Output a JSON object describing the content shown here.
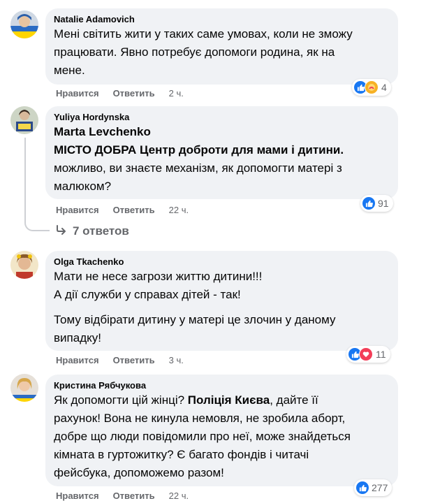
{
  "comments": [
    {
      "author": "Natalie Adamovich",
      "lines": [
        "Мені світить жити у таких саме умовах, коли не зможу",
        "працювати. Явно потребує допомоги родина, як на",
        "мене."
      ],
      "like_label": "Нравится",
      "reply_label": "Ответить",
      "time": "2 ч.",
      "reaction_count": "4"
    },
    {
      "author": "Yuliya Hordynska",
      "mention_1": "Marta Levchenko",
      "mention_2": "МІСТО ДОБРА Центр доброти для мами і дитини.",
      "lines": [
        "можливо, ви знаєте механізм, як допомогти матері з",
        "малюком?"
      ],
      "like_label": "Нравится",
      "reply_label": "Ответить",
      "time": "22 ч.",
      "reaction_count": "91",
      "replies_label": "7 ответов"
    },
    {
      "author": "Olga Tkachenko",
      "lines": [
        "Мати не несе загрози життю дитини!!!",
        "А дії служби у справах дітей - так!"
      ],
      "lines_2": [
        "Тому відбірати дитину у матері це злочин у даному",
        "випадку!"
      ],
      "like_label": "Нравится",
      "reply_label": "Ответить",
      "time": "3 ч.",
      "reaction_count": "11"
    },
    {
      "author": "Кристина Рябчукова",
      "line_1_pre": "Як допомогти цій жінці? ",
      "line_1_bold": "Поліція Києва",
      "line_1_post": ", дайте її",
      "lines": [
        "рахунок! Вона не кинула немовля, не зробила аборт,",
        "добре що люди повідомили про неї, може знайдеться",
        "кімната в гуртожитку? Є багато фондів і читачі",
        "фейсбука, допоможемо разом!"
      ],
      "like_label": "Нравится",
      "reply_label": "Ответить",
      "time": "22 ч.",
      "reaction_count": "277"
    }
  ],
  "colors": {
    "bubble": "#f0f2f5",
    "meta": "#65676b",
    "like": "#1877f2",
    "love": "#f33e58",
    "care": "#f7b125"
  },
  "icons": [
    "like-reaction-icon",
    "love-reaction-icon",
    "care-reaction-icon",
    "reply-arrow-icon"
  ]
}
